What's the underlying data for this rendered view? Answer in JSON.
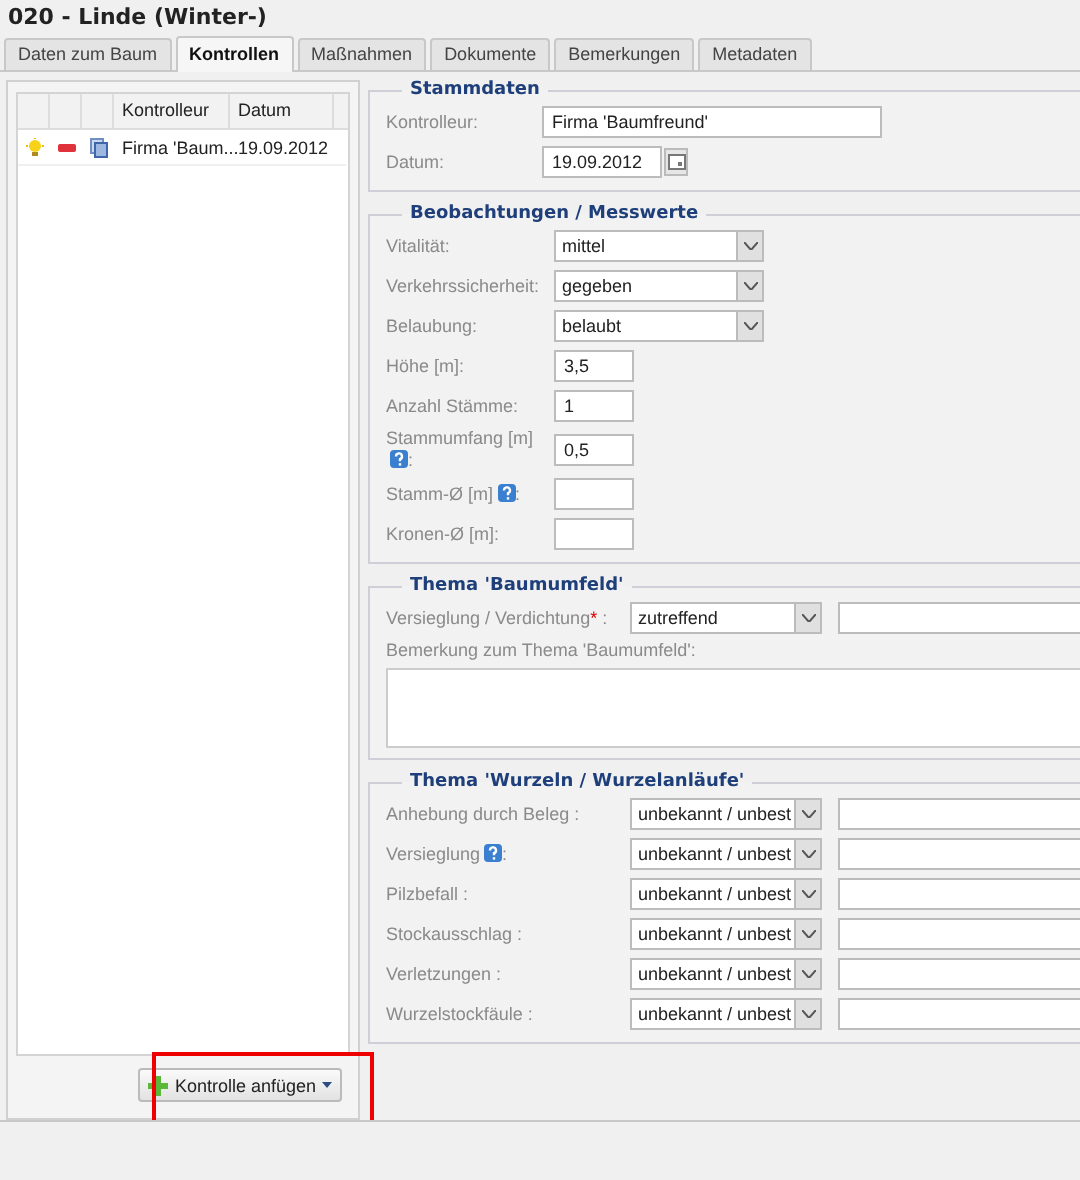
{
  "title": "020 - Linde (Winter-)",
  "tabs": [
    {
      "label": "Daten zum Baum",
      "selected": false
    },
    {
      "label": "Kontrollen",
      "selected": true
    },
    {
      "label": "Maßnahmen",
      "selected": false
    },
    {
      "label": "Dokumente",
      "selected": false
    },
    {
      "label": "Bemerkungen",
      "selected": false
    },
    {
      "label": "Metadaten",
      "selected": false
    }
  ],
  "controls_list": {
    "columns": [
      "Kontrolleur",
      "Datum"
    ],
    "rows": [
      {
        "kontrolleur": "Firma 'Baum...",
        "datum": "19.09.2012"
      }
    ],
    "add_button": "Kontrolle anfügen"
  },
  "sections": [
    {
      "title": "Stammdaten",
      "fields": [
        {
          "kind": "text",
          "label": "Kontrolleur:",
          "value": "Firma 'Baumfreund'"
        },
        {
          "kind": "date",
          "label": "Datum:",
          "value": "19.09.2012"
        }
      ]
    },
    {
      "title": "Beobachtungen / Messwerte",
      "fields": [
        {
          "kind": "select",
          "label": "Vitalität:",
          "value": "mittel"
        },
        {
          "kind": "select",
          "label": "Verkehrssicherheit:",
          "value": "gegeben"
        },
        {
          "kind": "select",
          "label": "Belaubung:",
          "value": "belaubt"
        },
        {
          "kind": "number",
          "label": "Höhe [m]:",
          "value": "3,5"
        },
        {
          "kind": "number",
          "label": "Anzahl Stämme:",
          "value": "1"
        },
        {
          "kind": "number",
          "label": "Stammumfang [m]",
          "help": true,
          "label_end": ":",
          "value": "0,5"
        },
        {
          "kind": "number",
          "label": "Stamm-Ø [m]",
          "help": true,
          "label_end": ":"
        },
        {
          "kind": "number",
          "label": "Kronen-Ø [m]:"
        }
      ]
    },
    {
      "title": "Thema 'Baumumfeld'",
      "fields": [
        {
          "kind": "select_note",
          "label": "Versieglung / Verdichtung",
          "required_mark": "*",
          "label_end": " :",
          "value": "zutreffend"
        },
        {
          "kind": "textarea",
          "label": "Bemerkung zum Thema 'Baumumfeld':"
        }
      ]
    },
    {
      "title": "Thema 'Wurzeln / Wurzelanläufe'",
      "fields": [
        {
          "kind": "select_note",
          "label": "Anhebung durch Beleg :",
          "value": "unbekannt / unbest"
        },
        {
          "kind": "select_note",
          "label": "Versieglung",
          "help": true,
          "label_end": ":",
          "value": "unbekannt / unbest"
        },
        {
          "kind": "select_note",
          "label": "Pilzbefall :",
          "value": "unbekannt / unbest"
        },
        {
          "kind": "select_note",
          "label": "Stockausschlag :",
          "value": "unbekannt / unbest"
        },
        {
          "kind": "select_note",
          "label": "Verletzungen :",
          "value": "unbekannt / unbest"
        },
        {
          "kind": "select_note",
          "label": "Wurzelstockfäule :",
          "value": "unbekannt / unbest"
        }
      ]
    }
  ]
}
